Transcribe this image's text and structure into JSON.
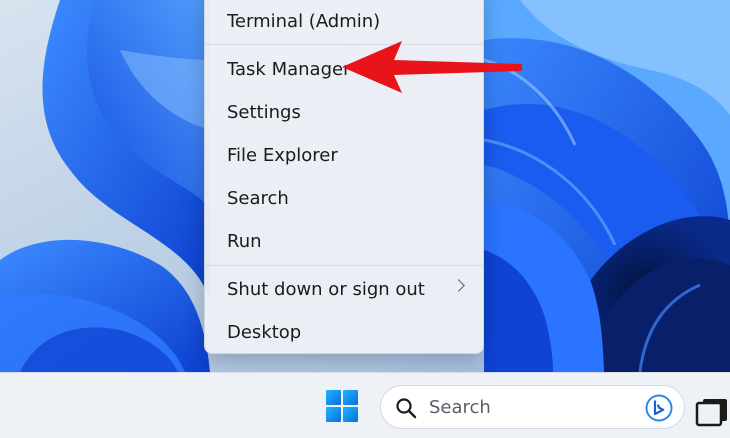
{
  "context_menu": {
    "items": [
      {
        "label": "Terminal (Admin)"
      },
      {
        "label": "Task Manager"
      },
      {
        "label": "Settings"
      },
      {
        "label": "File Explorer"
      },
      {
        "label": "Search"
      },
      {
        "label": "Run"
      },
      {
        "label": "Shut down or sign out"
      },
      {
        "label": "Desktop"
      }
    ]
  },
  "taskbar": {
    "start_icon": "windows-logo-icon",
    "search": {
      "label": "Search",
      "icon": "search-icon",
      "copilot_icon": "bing-icon"
    },
    "task_view_icon": "task-view-icon"
  },
  "annotation": {
    "pointer": "red arrow pointing to Task Manager",
    "color": "#e8141a"
  },
  "colors": {
    "wallpaper_blue": "#1f6fff",
    "menu_bg": "#eceff6",
    "taskbar_bg": "#eef1f6",
    "accent": "#0a6fd8"
  }
}
